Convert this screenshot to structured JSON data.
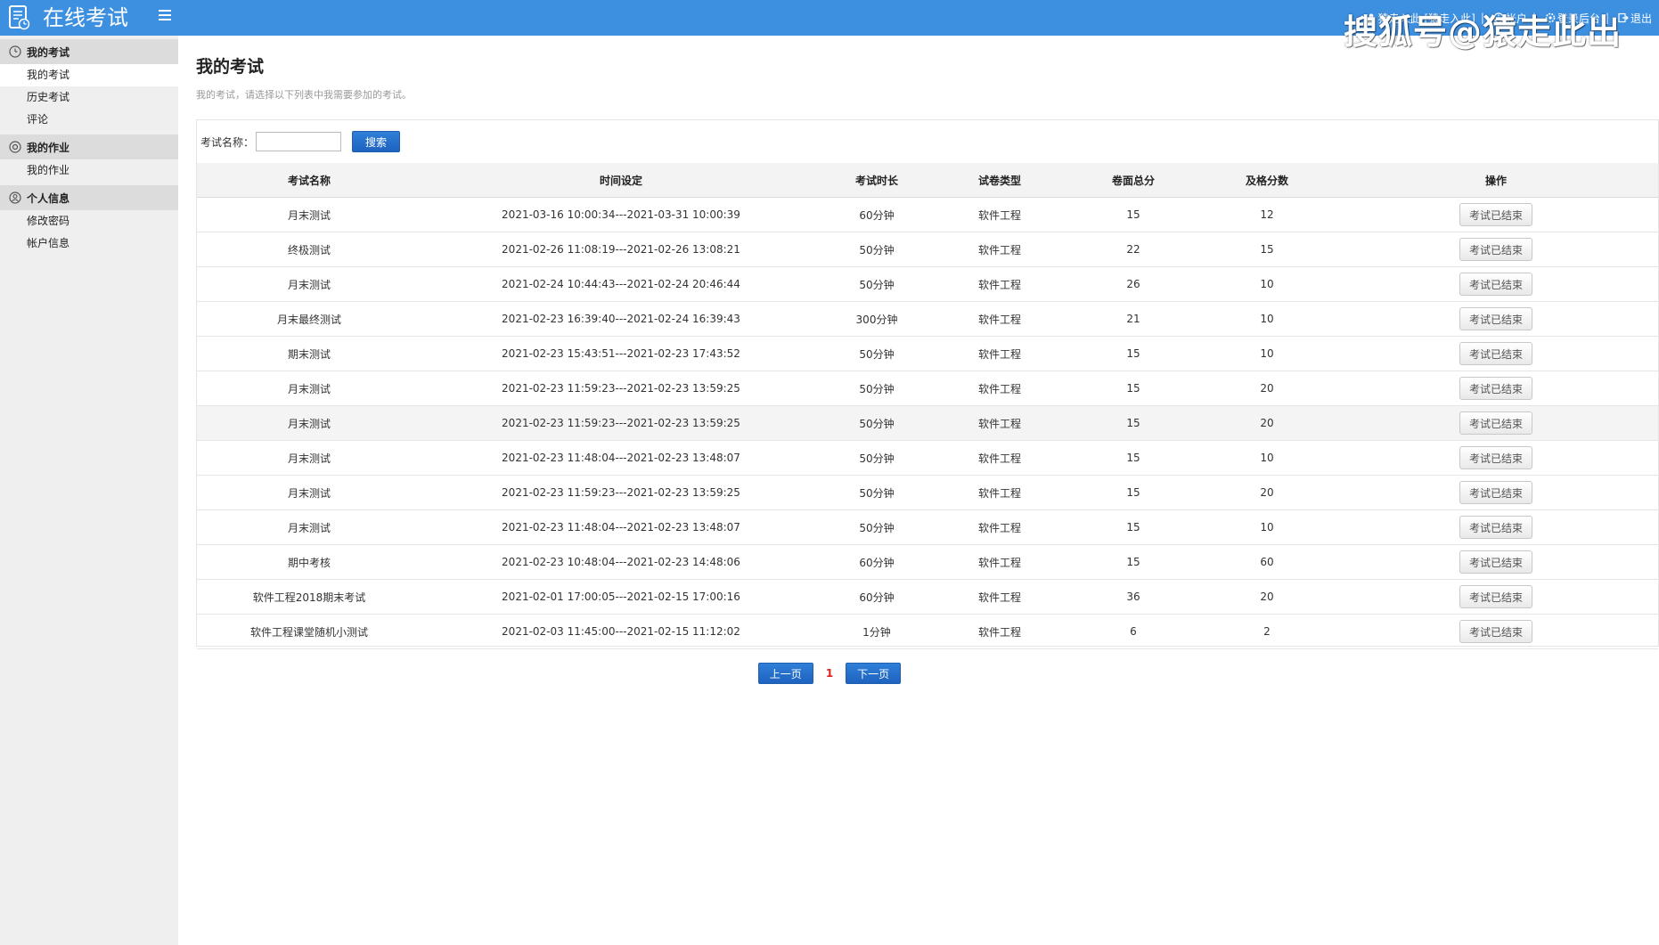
{
  "header": {
    "app_title": "在线考试",
    "links": [
      {
        "label": "猿走入此 [猿走入此]",
        "icon": "user-icon"
      },
      {
        "label": "帐户",
        "icon": "info-circle-icon"
      },
      {
        "label": "登录后台",
        "icon": "gear-icon"
      },
      {
        "label": "退出",
        "icon": "logout-icon"
      }
    ],
    "separator": "|",
    "watermark": "搜狐号@猿走此出"
  },
  "sidebar": {
    "groups": [
      {
        "title": "我的考试",
        "icon": "clock-icon",
        "items": [
          "我的考试",
          "历史考试",
          "评论"
        ]
      },
      {
        "title": "我的作业",
        "icon": "settings-circle-icon",
        "items": [
          "我的作业"
        ]
      },
      {
        "title": "个人信息",
        "icon": "person-circle-icon",
        "items": [
          "修改密码",
          "帐户信息"
        ]
      }
    ],
    "active_item": "我的考试"
  },
  "main": {
    "title": "我的考试",
    "description": "我的考试，请选择以下列表中我需要参加的考试。",
    "search": {
      "label": "考试名称：",
      "value": "",
      "placeholder": "",
      "button": "搜索"
    },
    "table": {
      "headers": [
        "考试名称",
        "时间设定",
        "考试时长",
        "试卷类型",
        "卷面总分",
        "及格分数",
        "操作"
      ],
      "rows": [
        {
          "name": "月末测试",
          "time": "2021-03-16 10:00:34---2021-03-31 10:00:39",
          "duration": "60分钟",
          "type": "软件工程",
          "total": "15",
          "pass": "12",
          "action": "考试已结束"
        },
        {
          "name": "终极测试",
          "time": "2021-02-26 11:08:19---2021-02-26 13:08:21",
          "duration": "50分钟",
          "type": "软件工程",
          "total": "22",
          "pass": "15",
          "action": "考试已结束"
        },
        {
          "name": "月末测试",
          "time": "2021-02-24 10:44:43---2021-02-24 20:46:44",
          "duration": "50分钟",
          "type": "软件工程",
          "total": "26",
          "pass": "10",
          "action": "考试已结束"
        },
        {
          "name": "月末最终测试",
          "time": "2021-02-23 16:39:40---2021-02-24 16:39:43",
          "duration": "300分钟",
          "type": "软件工程",
          "total": "21",
          "pass": "10",
          "action": "考试已结束"
        },
        {
          "name": "期末测试",
          "time": "2021-02-23 15:43:51---2021-02-23 17:43:52",
          "duration": "50分钟",
          "type": "软件工程",
          "total": "15",
          "pass": "10",
          "action": "考试已结束"
        },
        {
          "name": "月末测试",
          "time": "2021-02-23 11:59:23---2021-02-23 13:59:25",
          "duration": "50分钟",
          "type": "软件工程",
          "total": "15",
          "pass": "20",
          "action": "考试已结束"
        },
        {
          "name": "月末测试",
          "time": "2021-02-23 11:59:23---2021-02-23 13:59:25",
          "duration": "50分钟",
          "type": "软件工程",
          "total": "15",
          "pass": "20",
          "action": "考试已结束"
        },
        {
          "name": "月末测试",
          "time": "2021-02-23 11:48:04---2021-02-23 13:48:07",
          "duration": "50分钟",
          "type": "软件工程",
          "total": "15",
          "pass": "10",
          "action": "考试已结束"
        },
        {
          "name": "月末测试",
          "time": "2021-02-23 11:59:23---2021-02-23 13:59:25",
          "duration": "50分钟",
          "type": "软件工程",
          "total": "15",
          "pass": "20",
          "action": "考试已结束"
        },
        {
          "name": "月末测试",
          "time": "2021-02-23 11:48:04---2021-02-23 13:48:07",
          "duration": "50分钟",
          "type": "软件工程",
          "total": "15",
          "pass": "10",
          "action": "考试已结束"
        },
        {
          "name": "期中考核",
          "time": "2021-02-23 10:48:04---2021-02-23 14:48:06",
          "duration": "60分钟",
          "type": "软件工程",
          "total": "15",
          "pass": "60",
          "action": "考试已结束"
        },
        {
          "name": "软件工程2018期末考试",
          "time": "2021-02-01 17:00:05---2021-02-15 17:00:16",
          "duration": "60分钟",
          "type": "软件工程",
          "total": "36",
          "pass": "20",
          "action": "考试已结束"
        },
        {
          "name": "软件工程课堂随机小测试",
          "time": "2021-02-03 11:45:00---2021-02-15 11:12:02",
          "duration": "1分钟",
          "type": "软件工程",
          "total": "6",
          "pass": "2",
          "action": "考试已结束"
        }
      ],
      "highlighted_row": 6
    },
    "pager": {
      "prev": "上一页",
      "current": "1",
      "next": "下一页"
    }
  },
  "colors": {
    "topbar": "#3d8fe0",
    "sidebar": "#efefef",
    "button_blue": "#1e63bf",
    "current_page": "#dd2222"
  }
}
